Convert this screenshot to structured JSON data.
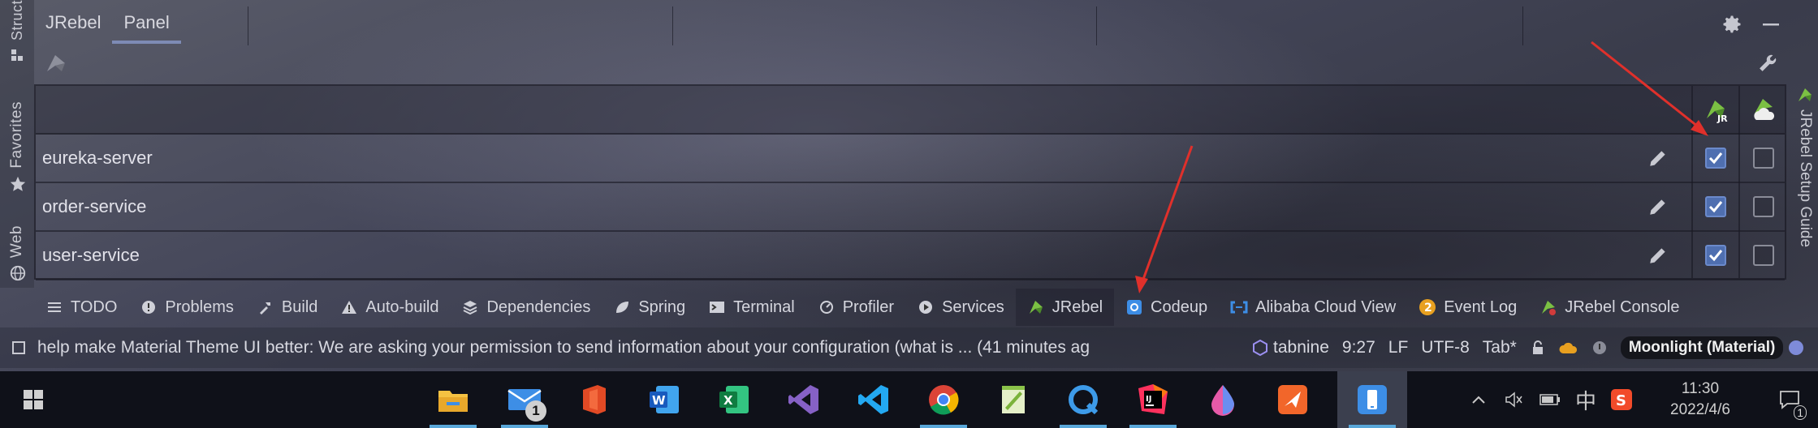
{
  "left_strip": {
    "tabs": [
      {
        "label": "Struct",
        "icon": "structure-icon"
      },
      {
        "label": "Favorites",
        "icon": "star-icon"
      },
      {
        "label": "Web",
        "icon": "globe-icon"
      }
    ]
  },
  "right_strip": {
    "label": "JRebel Setup Guide",
    "icon": "jrebel-icon"
  },
  "panel": {
    "tabs": [
      {
        "label": "JRebel",
        "active": false
      },
      {
        "label": "Panel",
        "active": true
      }
    ]
  },
  "table": {
    "header_icons": [
      "jrebel-jr-icon",
      "jrebel-cloud-icon"
    ],
    "rows": [
      {
        "name": "eureka-server",
        "jrebel": true,
        "remote": false
      },
      {
        "name": "order-service",
        "jrebel": true,
        "remote": false
      },
      {
        "name": "user-service",
        "jrebel": true,
        "remote": false
      }
    ]
  },
  "toolwindows": [
    {
      "label": "TODO",
      "icon": "list-icon",
      "active": false
    },
    {
      "label": "Problems",
      "icon": "problems-icon",
      "active": false
    },
    {
      "label": "Build",
      "icon": "hammer-icon",
      "active": false
    },
    {
      "label": "Auto-build",
      "icon": "warning-icon",
      "active": false
    },
    {
      "label": "Dependencies",
      "icon": "layers-icon",
      "active": false
    },
    {
      "label": "Spring",
      "icon": "leaf-icon",
      "active": false
    },
    {
      "label": "Terminal",
      "icon": "terminal-icon",
      "active": false
    },
    {
      "label": "Profiler",
      "icon": "profiler-icon",
      "active": false
    },
    {
      "label": "Services",
      "icon": "services-icon",
      "active": false
    },
    {
      "label": "JRebel",
      "icon": "jrebel-icon",
      "active": true
    },
    {
      "label": "Codeup",
      "icon": "codeup-icon",
      "active": false
    },
    {
      "label": "Alibaba Cloud View",
      "icon": "alibaba-cloud-icon",
      "active": false
    },
    {
      "label": "Event Log",
      "icon": "event-log-icon",
      "active": false,
      "badge": "2"
    },
    {
      "label": "JRebel Console",
      "icon": "jrebel-console-icon",
      "active": false
    }
  ],
  "status_bar": {
    "message": "help make Material Theme UI better: We are asking your permission to send information about your configuration (what is ... (41 minutes ag",
    "tabnine": "tabnine",
    "position": "9:27",
    "line_sep": "LF",
    "encoding": "UTF-8",
    "indent": "Tab*",
    "theme": "Moonlight (Material)"
  },
  "taskbar": {
    "apps": [
      {
        "name": "file-explorer-icon",
        "running": true,
        "focused": false
      },
      {
        "name": "mail-icon",
        "running": true,
        "focused": false,
        "badge": "1"
      },
      {
        "name": "office-icon",
        "running": false,
        "focused": false
      },
      {
        "name": "word-icon",
        "running": false,
        "focused": false
      },
      {
        "name": "excel-icon",
        "running": false,
        "focused": false
      },
      {
        "name": "visual-studio-icon",
        "running": false,
        "focused": false
      },
      {
        "name": "vscode-icon",
        "running": false,
        "focused": false
      },
      {
        "name": "chrome-icon",
        "running": true,
        "focused": false
      },
      {
        "name": "notepad-icon",
        "running": false,
        "focused": false
      },
      {
        "name": "qq-icon",
        "running": true,
        "focused": false
      },
      {
        "name": "intellij-icon",
        "running": true,
        "focused": false
      },
      {
        "name": "drop-icon",
        "running": false,
        "focused": false
      },
      {
        "name": "send-icon",
        "running": false,
        "focused": false
      },
      {
        "name": "phone-link-icon",
        "running": true,
        "focused": true
      }
    ],
    "ime": "中",
    "time": "11:30",
    "date": "2022/4/6",
    "notifications": "1"
  },
  "colors": {
    "accent": "#4f6fb0",
    "arrow": "#e0302b",
    "jrebel_green": "#7bc043"
  }
}
